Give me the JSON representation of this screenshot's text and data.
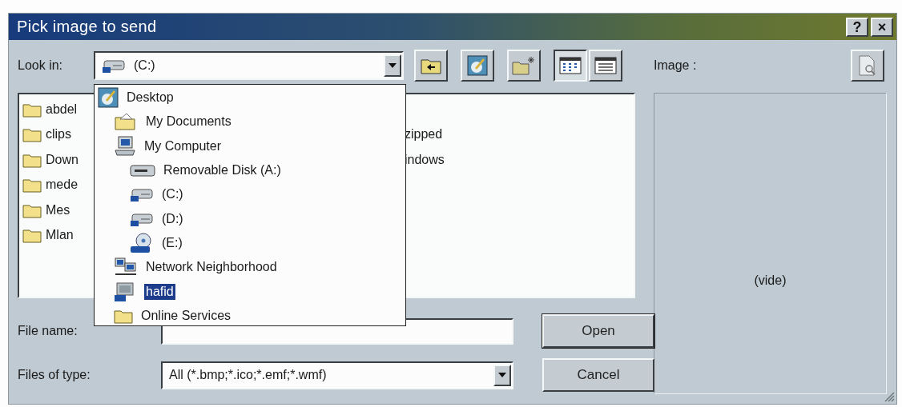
{
  "window": {
    "title": "Pick image to send",
    "title_buttons": [
      "?",
      "×"
    ]
  },
  "look_in": {
    "label": "Look in:",
    "value": "(C:)"
  },
  "toolbar": {
    "view_buttons": [
      {
        "selected": true
      },
      {
        "selected": false
      }
    ]
  },
  "locations": [
    {
      "label": "Desktop",
      "kind": "desktop",
      "selected": false,
      "children": [
        {
          "label": "My Documents",
          "kind": "documents",
          "selected": false
        },
        {
          "label": "My Computer",
          "kind": "computer",
          "selected": false,
          "children": [
            {
              "label": "Removable Disk (A:)",
              "kind": "floppy",
              "selected": false
            },
            {
              "label": "(C:)",
              "kind": "drive",
              "selected": false
            },
            {
              "label": "(D:)",
              "kind": "drive",
              "selected": false
            },
            {
              "label": "(E:)",
              "kind": "cd",
              "selected": false
            }
          ]
        },
        {
          "label": "Network Neighborhood",
          "kind": "network",
          "selected": false
        },
        {
          "label": "hafid",
          "kind": "share",
          "selected": true
        },
        {
          "label": "Online Services",
          "kind": "folder",
          "selected": false
        }
      ]
    }
  ],
  "files": {
    "column_1": [
      "abdel",
      "clips",
      "Down",
      "mede",
      "Mes",
      "Mlan"
    ],
    "column_2": [
      "zipped",
      "indows"
    ]
  },
  "file_name": {
    "label": "File name:"
  },
  "files_of_type": {
    "label": "Files of type:",
    "value": "All (*.bmp;*.ico;*.emf;*.wmf)"
  },
  "buttons": [
    "Open",
    "Cancel"
  ],
  "preview": {
    "label": "Image :",
    "empty_text": "(vide)"
  }
}
